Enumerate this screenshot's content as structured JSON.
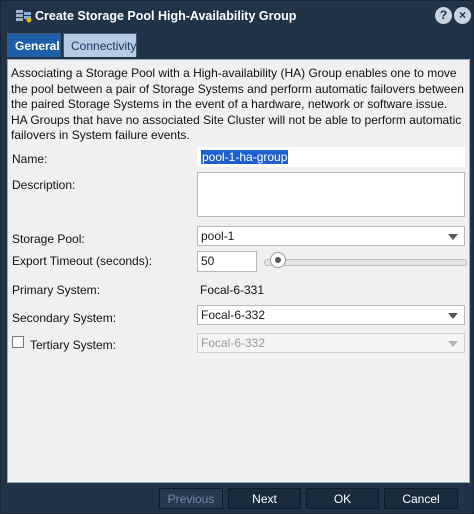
{
  "window": {
    "title": "Create Storage Pool High-Availability Group",
    "help_label": "?",
    "close_label": "×"
  },
  "tabs": [
    {
      "label": "General",
      "active": true
    },
    {
      "label": "Connectivity",
      "active": false
    }
  ],
  "description": "Associating a Storage Pool with a High-availability (HA) Group enables one to move the pool between a pair of Storage Systems and perform automatic failovers between the paired Storage Systems in the event of a hardware, network or software issue. HA Groups that have no associated Site Cluster will not be able to perform automatic failovers in System failure events.",
  "form": {
    "name_label": "Name:",
    "name_value": "pool-1-ha-group",
    "description_label": "Description:",
    "description_value": "",
    "storage_pool_label": "Storage Pool:",
    "storage_pool_value": "pool-1",
    "export_timeout_label": "Export Timeout (seconds):",
    "export_timeout_value": "50",
    "primary_system_label": "Primary System:",
    "primary_system_value": "Focal-6-331",
    "secondary_system_label": "Secondary System:",
    "secondary_system_value": "Focal-6-332",
    "tertiary_system_label": "Tertiary System:",
    "tertiary_system_value": "Focal-6-332",
    "tertiary_checked": false
  },
  "footer": {
    "previous_label": "Previous",
    "next_label": "Next",
    "ok_label": "OK",
    "cancel_label": "Cancel"
  }
}
